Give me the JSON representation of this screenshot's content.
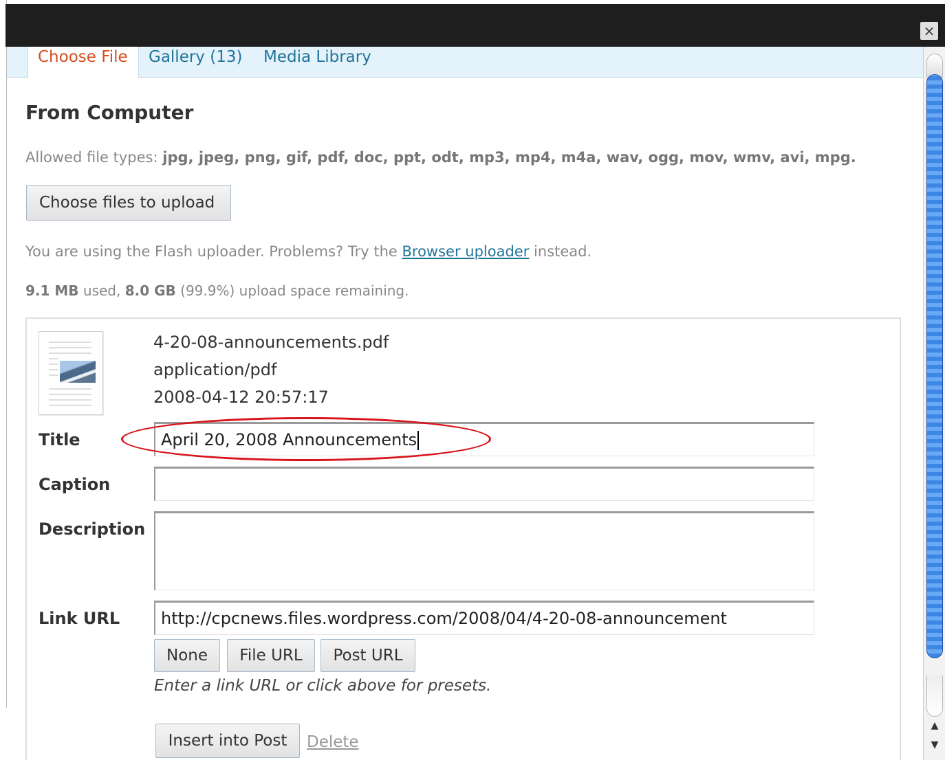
{
  "dialog": {
    "close_label": "×"
  },
  "tabs": [
    {
      "label": "Choose File",
      "active": true
    },
    {
      "label": "Gallery (13)",
      "active": false
    },
    {
      "label": "Media Library",
      "active": false
    }
  ],
  "upload": {
    "heading": "From Computer",
    "allowed_prefix": "Allowed file types:",
    "allowed_types": "jpg, jpeg, png, gif, pdf, doc, ppt, odt, mp3, mp4, m4a, wav, ogg, mov, wmv, avi, mpg.",
    "choose_button": "Choose files to upload",
    "flash_prefix": "You are using the Flash uploader. Problems? Try the",
    "flash_link": "Browser uploader",
    "flash_suffix": "instead.",
    "quota_used": "9.1 MB",
    "quota_used_text": "used,",
    "quota_remaining": "8.0 GB",
    "quota_percent": "(99.9%)",
    "quota_suffix": "upload space remaining."
  },
  "file": {
    "name": "4-20-08-announcements.pdf",
    "mime": "application/pdf",
    "date": "2008-04-12 20:57:17",
    "fields": {
      "title_label": "Title",
      "title_value": "April 20, 2008 Announcements",
      "caption_label": "Caption",
      "caption_value": "",
      "description_label": "Description",
      "description_value": "",
      "link_label": "Link URL",
      "link_value": "http://cpcnews.files.wordpress.com/2008/04/4-20-08-announcement"
    },
    "presets": {
      "none": "None",
      "file_url": "File URL",
      "post_url": "Post URL",
      "help": "Enter a link URL or click above for presets."
    },
    "actions": {
      "insert": "Insert into Post",
      "delete": "Delete"
    }
  },
  "annotation": {
    "highlight_color": "#d9141b"
  },
  "colors": {
    "active_tab_text": "#d54e21",
    "tab_text": "#21759b",
    "tab_bar_bg": "#e4f2fc",
    "top_bar_bg": "#1e1e1e",
    "scroll_thumb": "#3e86e6"
  }
}
